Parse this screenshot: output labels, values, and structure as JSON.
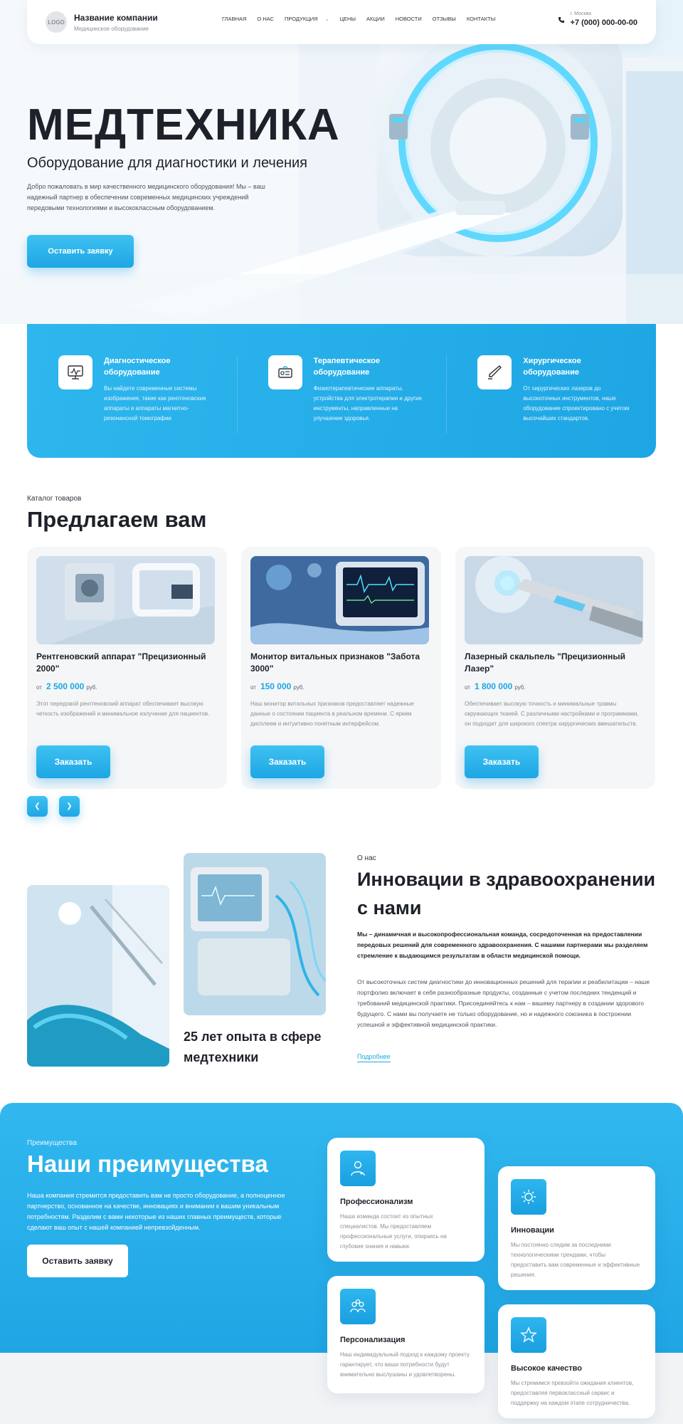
{
  "header": {
    "logo_text": "LOGO",
    "company_name": "Название компании",
    "company_sub": "Медицинское оборудование",
    "nav": [
      {
        "label": "Главная"
      },
      {
        "label": "О нас"
      },
      {
        "label": "Продукция"
      },
      {
        "label": "Цены"
      },
      {
        "label": "Акции"
      },
      {
        "label": "Новости"
      },
      {
        "label": "Отзывы"
      },
      {
        "label": "Контакты"
      }
    ],
    "city": "г. Москва",
    "phone": "+7 (000) 000-00-00"
  },
  "hero": {
    "title": "МЕДТЕХНИКА",
    "subtitle": "Оборудование для диагностики и лечения",
    "text": "Добро пожаловать в мир качественного медицинского оборудования! Мы – ваш надежный партнер в обеспечении современных медицинских учреждений передовыми технологиями и высококлассным оборудованием.",
    "button": "Оставить заявку"
  },
  "categories": [
    {
      "title": "Диагностическое оборудование",
      "text": "Вы найдете современные системы изображения, такие как рентгеновские аппараты и аппараты магнитно-резонансной томографии",
      "icon": "monitor-icon"
    },
    {
      "title": "Терапевтическое оборудование",
      "text": "Физиотерапевтические аппараты, устройства для электротерапии и другие инструменты, направленные на улучшение здоровья.",
      "icon": "therapy-device-icon"
    },
    {
      "title": "Хирургическое оборудование",
      "text": "От хирургических лазеров до высокоточных инструментов, наше оборудование спроектировано с учетом высочайших стандартов.",
      "icon": "scalpel-icon"
    }
  ],
  "catalog": {
    "eyebrow": "Каталог товаров",
    "title": "Предлагаем вам",
    "products": [
      {
        "name": "Рентгеновский аппарат \"Прецизионный 2000\"",
        "from": "от",
        "price": "2 500 000",
        "currency": "руб.",
        "text": "Этот передовой рентгеновский аппарат обеспечивает высокую четкость изображений и минимальное излучение для пациентов.",
        "button": "Заказать"
      },
      {
        "name": "Монитор витальных признаков \"Забота 3000\"",
        "from": "от",
        "price": "150 000",
        "currency": "руб.",
        "text": "Наш монитор витальных признаков предоставляет надежные данные о состоянии пациента в реальном времени. С ярким дисплеем и интуитивно понятным интерфейсом.",
        "button": "Заказать"
      },
      {
        "name": "Лазерный скальпель \"Прецизионный Лазер\"",
        "from": "от",
        "price": "1 800 000",
        "currency": "руб.",
        "text": "Обеспечивает высокую точность и минимальные травмы окружающих тканей. С различными настройками и программами, он подходит для широкого спектра хирургических вмешательств.",
        "button": "Заказать"
      }
    ],
    "prev_icon": "chevron-left-icon",
    "next_icon": "chevron-right-icon"
  },
  "about": {
    "experience": "25 лет опыта в сфере медтехники",
    "eyebrow": "О нас",
    "title": "Инновации в здравоохранении с нами",
    "lead": "Мы – динамичная и высокопрофессиональная команда, сосредоточенная на предоставлении передовых решений для современного здравоохранения. С нашими партнерами мы разделяем стремление к выдающимся результатам в области медицинской помощи.",
    "text": "От высокоточных систем диагностики до инновационных решений для терапии и реабилитации – наше портфолио включает в себя разнообразные продукты, созданные с учетом последних тенденций и требований медицинской практики. Присоединяйтесь к нам – вашему партнеру в создании здорового будущего. С нами вы получаете не только оборудование, но и надежного союзника в построении успешной и эффективной медицинской практики.",
    "link": "Подробнее"
  },
  "advantages": {
    "eyebrow": "Преимущества",
    "title": "Наши преимущества",
    "text": "Наша компания стремится предоставить вам не просто оборудование, а полноценное партнерство, основанное на качестве, инновациях и внимании к вашим уникальным потребностям. Разделим с вами некоторые из наших главных преимуществ, которые сделают ваш опыт с нашей компанией непревзойденным.",
    "button": "Оставить заявку",
    "items": [
      {
        "title": "Профессионализм",
        "text": "Наша команда состоит из опытных специалистов. Мы предоставляем профессиональные услуги, опираясь на глубокие знания и навыки.",
        "icon": "doctor-icon"
      },
      {
        "title": "Инновации",
        "text": "Мы постоянно следим за последними технологическими трендами, чтобы предоставить вам современные и эффективные решения.",
        "icon": "innovation-icon"
      },
      {
        "title": "Персонализация",
        "text": "Наш индивидуальный подход к каждому проекту гарантирует, что ваши потребности будут внимательно выслушаны и удовлетворены.",
        "icon": "people-icon"
      },
      {
        "title": "Высокое качество",
        "text": "Мы стремимся превзойти ожидания клиентов, предоставляя первоклассный сервис и поддержку на каждом этапе сотрудничества.",
        "icon": "star-icon"
      }
    ]
  }
}
